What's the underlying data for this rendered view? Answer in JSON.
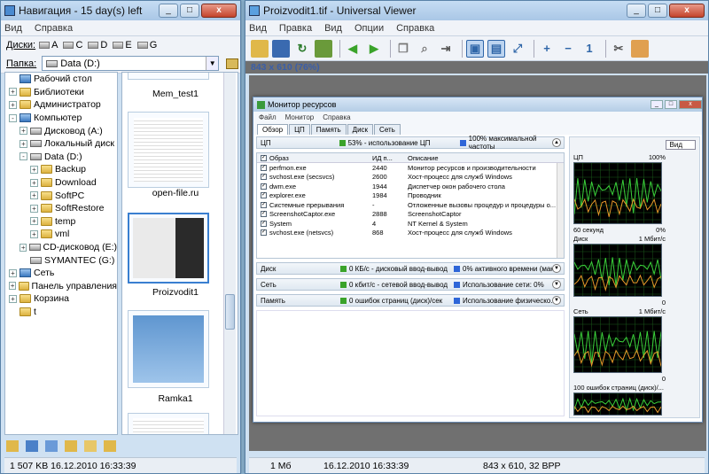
{
  "nav": {
    "title": "Навигация - 15 day(s) left",
    "menu": [
      "Вид",
      "Справка"
    ],
    "drives_label": "Диски:",
    "drives": [
      "A",
      "C",
      "D",
      "E",
      "G"
    ],
    "folder_label": "Папка:",
    "folder_value": "Data (D:)",
    "tree": [
      {
        "label": "Рабочий стол",
        "level": 0,
        "icon": "desktop-icon",
        "exp": ""
      },
      {
        "label": "Библиотеки",
        "level": 0,
        "icon": "folder-icon",
        "exp": "+"
      },
      {
        "label": "Администратор",
        "level": 0,
        "icon": "folder-icon",
        "exp": "+"
      },
      {
        "label": "Компьютер",
        "level": 0,
        "icon": "computer-icon",
        "exp": "-"
      },
      {
        "label": "Дисковод (A:)",
        "level": 1,
        "icon": "drive-icon",
        "exp": "+"
      },
      {
        "label": "Локальный диск",
        "level": 1,
        "icon": "drive-icon",
        "exp": "+"
      },
      {
        "label": "Data (D:)",
        "level": 1,
        "icon": "drive-icon",
        "exp": "-"
      },
      {
        "label": "Backup",
        "level": 2,
        "icon": "folder-icon",
        "exp": "+"
      },
      {
        "label": "Download",
        "level": 2,
        "icon": "folder-icon",
        "exp": "+"
      },
      {
        "label": "SoftPC",
        "level": 2,
        "icon": "folder-icon",
        "exp": "+"
      },
      {
        "label": "SoftRestore",
        "level": 2,
        "icon": "folder-icon",
        "exp": "+"
      },
      {
        "label": "temp",
        "level": 2,
        "icon": "folder-icon",
        "exp": "+"
      },
      {
        "label": "vml",
        "level": 2,
        "icon": "folder-icon",
        "exp": "+"
      },
      {
        "label": "CD-дисковод (E:)",
        "level": 1,
        "icon": "cd-icon",
        "exp": "+"
      },
      {
        "label": "SYMANTEC (G:)",
        "level": 1,
        "icon": "drive-icon",
        "exp": ""
      },
      {
        "label": "Сеть",
        "level": 0,
        "icon": "network-icon",
        "exp": "+"
      },
      {
        "label": "Панель управления",
        "level": 0,
        "icon": "control-panel-icon",
        "exp": "+"
      },
      {
        "label": "Корзина",
        "level": 0,
        "icon": "recycle-bin-icon",
        "exp": "+"
      },
      {
        "label": "t",
        "level": 0,
        "icon": "folder-icon",
        "exp": ""
      }
    ],
    "thumbs": [
      "Mem_test1",
      "open-file.ru",
      "Proizvodit1",
      "Ramka1"
    ],
    "status": "1 507 KB  16.12.2010 16:33:39"
  },
  "uv": {
    "title": "Proizvodit1.tif - Universal Viewer",
    "menu": [
      "Вид",
      "Правка",
      "Вид",
      "Опции",
      "Справка"
    ],
    "info": "843 x 610 (76%)",
    "status_size": "1 Мб",
    "status_date": "16.12.2010 16:33:39",
    "status_dims": "843 x 610, 32 BPP",
    "colors": {
      "accent": "#2f66a8",
      "green_btn": "#3aa32a"
    }
  },
  "rm": {
    "title": "Монитор ресурсов",
    "menu": [
      "Файл",
      "Монитор",
      "Справка"
    ],
    "tabs": [
      "Обзор",
      "ЦП",
      "Память",
      "Диск",
      "Сеть"
    ],
    "cpu": {
      "name": "ЦП",
      "usage": "53% - использование ЦП",
      "freq": "100% максимальной частоты"
    },
    "cols": [
      "Образ",
      "ИД п...",
      "Описание"
    ],
    "rows": [
      [
        "perfmon.exe",
        "2440",
        "Монитор ресурсов и производительности"
      ],
      [
        "svchost.exe (secsvcs)",
        "2600",
        "Хост-процесс для служб Windows"
      ],
      [
        "dwm.exe",
        "1944",
        "Диспетчер окон рабочего стола"
      ],
      [
        "explorer.exe",
        "1984",
        "Проводник"
      ],
      [
        "Системные прерывания",
        "-",
        "Отложенные вызовы процедур и процедуры о..."
      ],
      [
        "ScreenshotCaptor.exe",
        "2888",
        "ScreenshotCaptor"
      ],
      [
        "System",
        "4",
        "NT Kernel & System"
      ],
      [
        "svchost.exe (netsvcs)",
        "868",
        "Хост-процесс для служб Windows"
      ]
    ],
    "disk": {
      "name": "Диск",
      "a": "0 КБ/с - дисковый ввод-вывод",
      "b": "0% активного времени (мак..."
    },
    "net": {
      "name": "Сеть",
      "a": "0 кбит/с - сетевой ввод-вывод",
      "b": "Использование сети: 0%"
    },
    "mem": {
      "name": "Память",
      "a": "0 ошибок страниц (диск)/сек",
      "b": "Использование физическо..."
    },
    "view_label": "Вид",
    "graphs": [
      {
        "name": "ЦП",
        "max": "100%",
        "bottom": "60 секунд",
        "bottom_r": "0%"
      },
      {
        "name": "Диск",
        "max": "1 Мбит/с",
        "bottom": "",
        "bottom_r": "0"
      },
      {
        "name": "Сеть",
        "max": "1 Мбит/с",
        "bottom": "",
        "bottom_r": "0"
      },
      {
        "name": "100 ошибок страниц (диск)/...",
        "max": "",
        "bottom": "",
        "bottom_r": ""
      }
    ]
  }
}
